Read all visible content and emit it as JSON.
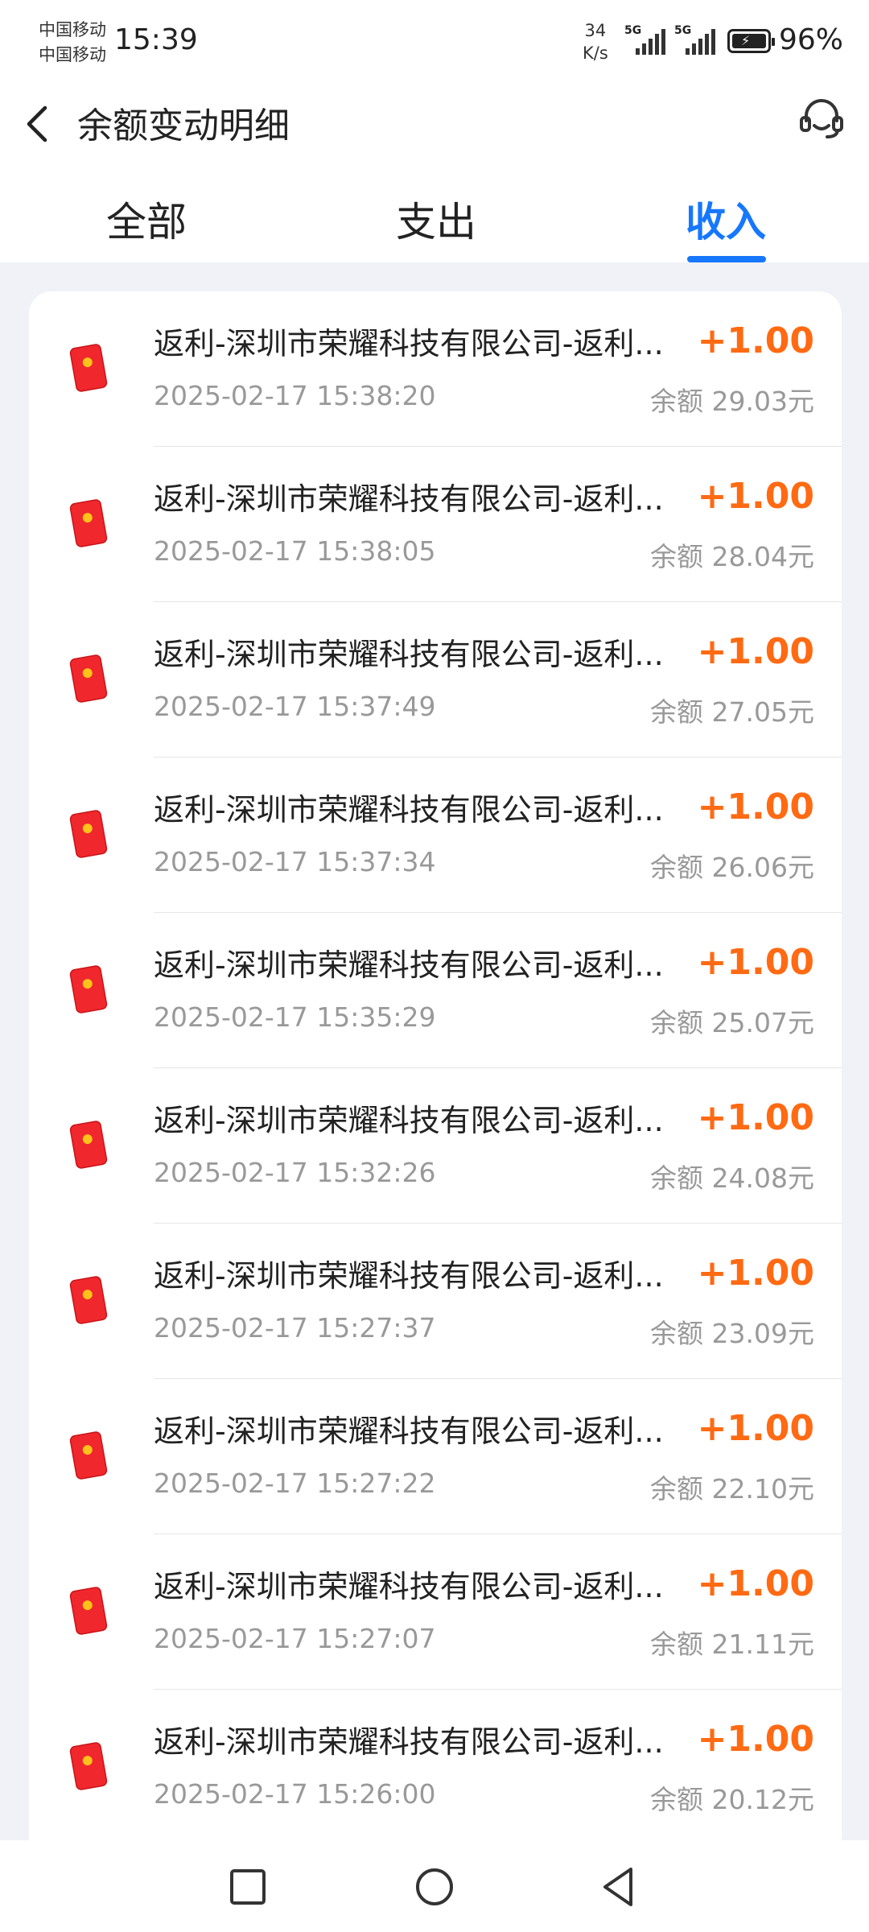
{
  "status_bar": {
    "carrier1": "中国移动",
    "carrier2": "中国移动",
    "time": "15:39",
    "net_speed_value": "34",
    "net_speed_unit": "K/s",
    "signal1": "5G",
    "signal2": "5G",
    "battery": "96%",
    "icons": [
      "signal-icon",
      "signal-icon",
      "battery-icon"
    ]
  },
  "header": {
    "title": "余额变动明细",
    "back_icon": "back-arrow-icon",
    "service_icon": "customer-service-icon"
  },
  "tabs": [
    {
      "label": "全部",
      "active": false
    },
    {
      "label": "支出",
      "active": false
    },
    {
      "label": "收入",
      "active": true
    }
  ],
  "colors": {
    "accent": "#1677ff",
    "amount": "#ff6a13",
    "red_packet": "#f0272c",
    "background": "#f0f2f7"
  },
  "transactions": [
    {
      "title": "返利-深圳市荣耀科技有限公司-返利...",
      "amount": "+1.00",
      "time": "2025-02-17 15:38:20",
      "balance": "余额 29.03元"
    },
    {
      "title": "返利-深圳市荣耀科技有限公司-返利...",
      "amount": "+1.00",
      "time": "2025-02-17 15:38:05",
      "balance": "余额 28.04元"
    },
    {
      "title": "返利-深圳市荣耀科技有限公司-返利...",
      "amount": "+1.00",
      "time": "2025-02-17 15:37:49",
      "balance": "余额 27.05元"
    },
    {
      "title": "返利-深圳市荣耀科技有限公司-返利...",
      "amount": "+1.00",
      "time": "2025-02-17 15:37:34",
      "balance": "余额 26.06元"
    },
    {
      "title": "返利-深圳市荣耀科技有限公司-返利...",
      "amount": "+1.00",
      "time": "2025-02-17 15:35:29",
      "balance": "余额 25.07元"
    },
    {
      "title": "返利-深圳市荣耀科技有限公司-返利...",
      "amount": "+1.00",
      "time": "2025-02-17 15:32:26",
      "balance": "余额 24.08元"
    },
    {
      "title": "返利-深圳市荣耀科技有限公司-返利...",
      "amount": "+1.00",
      "time": "2025-02-17 15:27:37",
      "balance": "余额 23.09元"
    },
    {
      "title": "返利-深圳市荣耀科技有限公司-返利...",
      "amount": "+1.00",
      "time": "2025-02-17 15:27:22",
      "balance": "余额 22.10元"
    },
    {
      "title": "返利-深圳市荣耀科技有限公司-返利...",
      "amount": "+1.00",
      "time": "2025-02-17 15:27:07",
      "balance": "余额 21.11元"
    },
    {
      "title": "返利-深圳市荣耀科技有限公司-返利...",
      "amount": "+1.00",
      "time": "2025-02-17 15:26:00",
      "balance": "余额 20.12元"
    }
  ],
  "nav_bar": {
    "icons": [
      "recent-apps-icon",
      "home-icon",
      "back-icon"
    ]
  }
}
